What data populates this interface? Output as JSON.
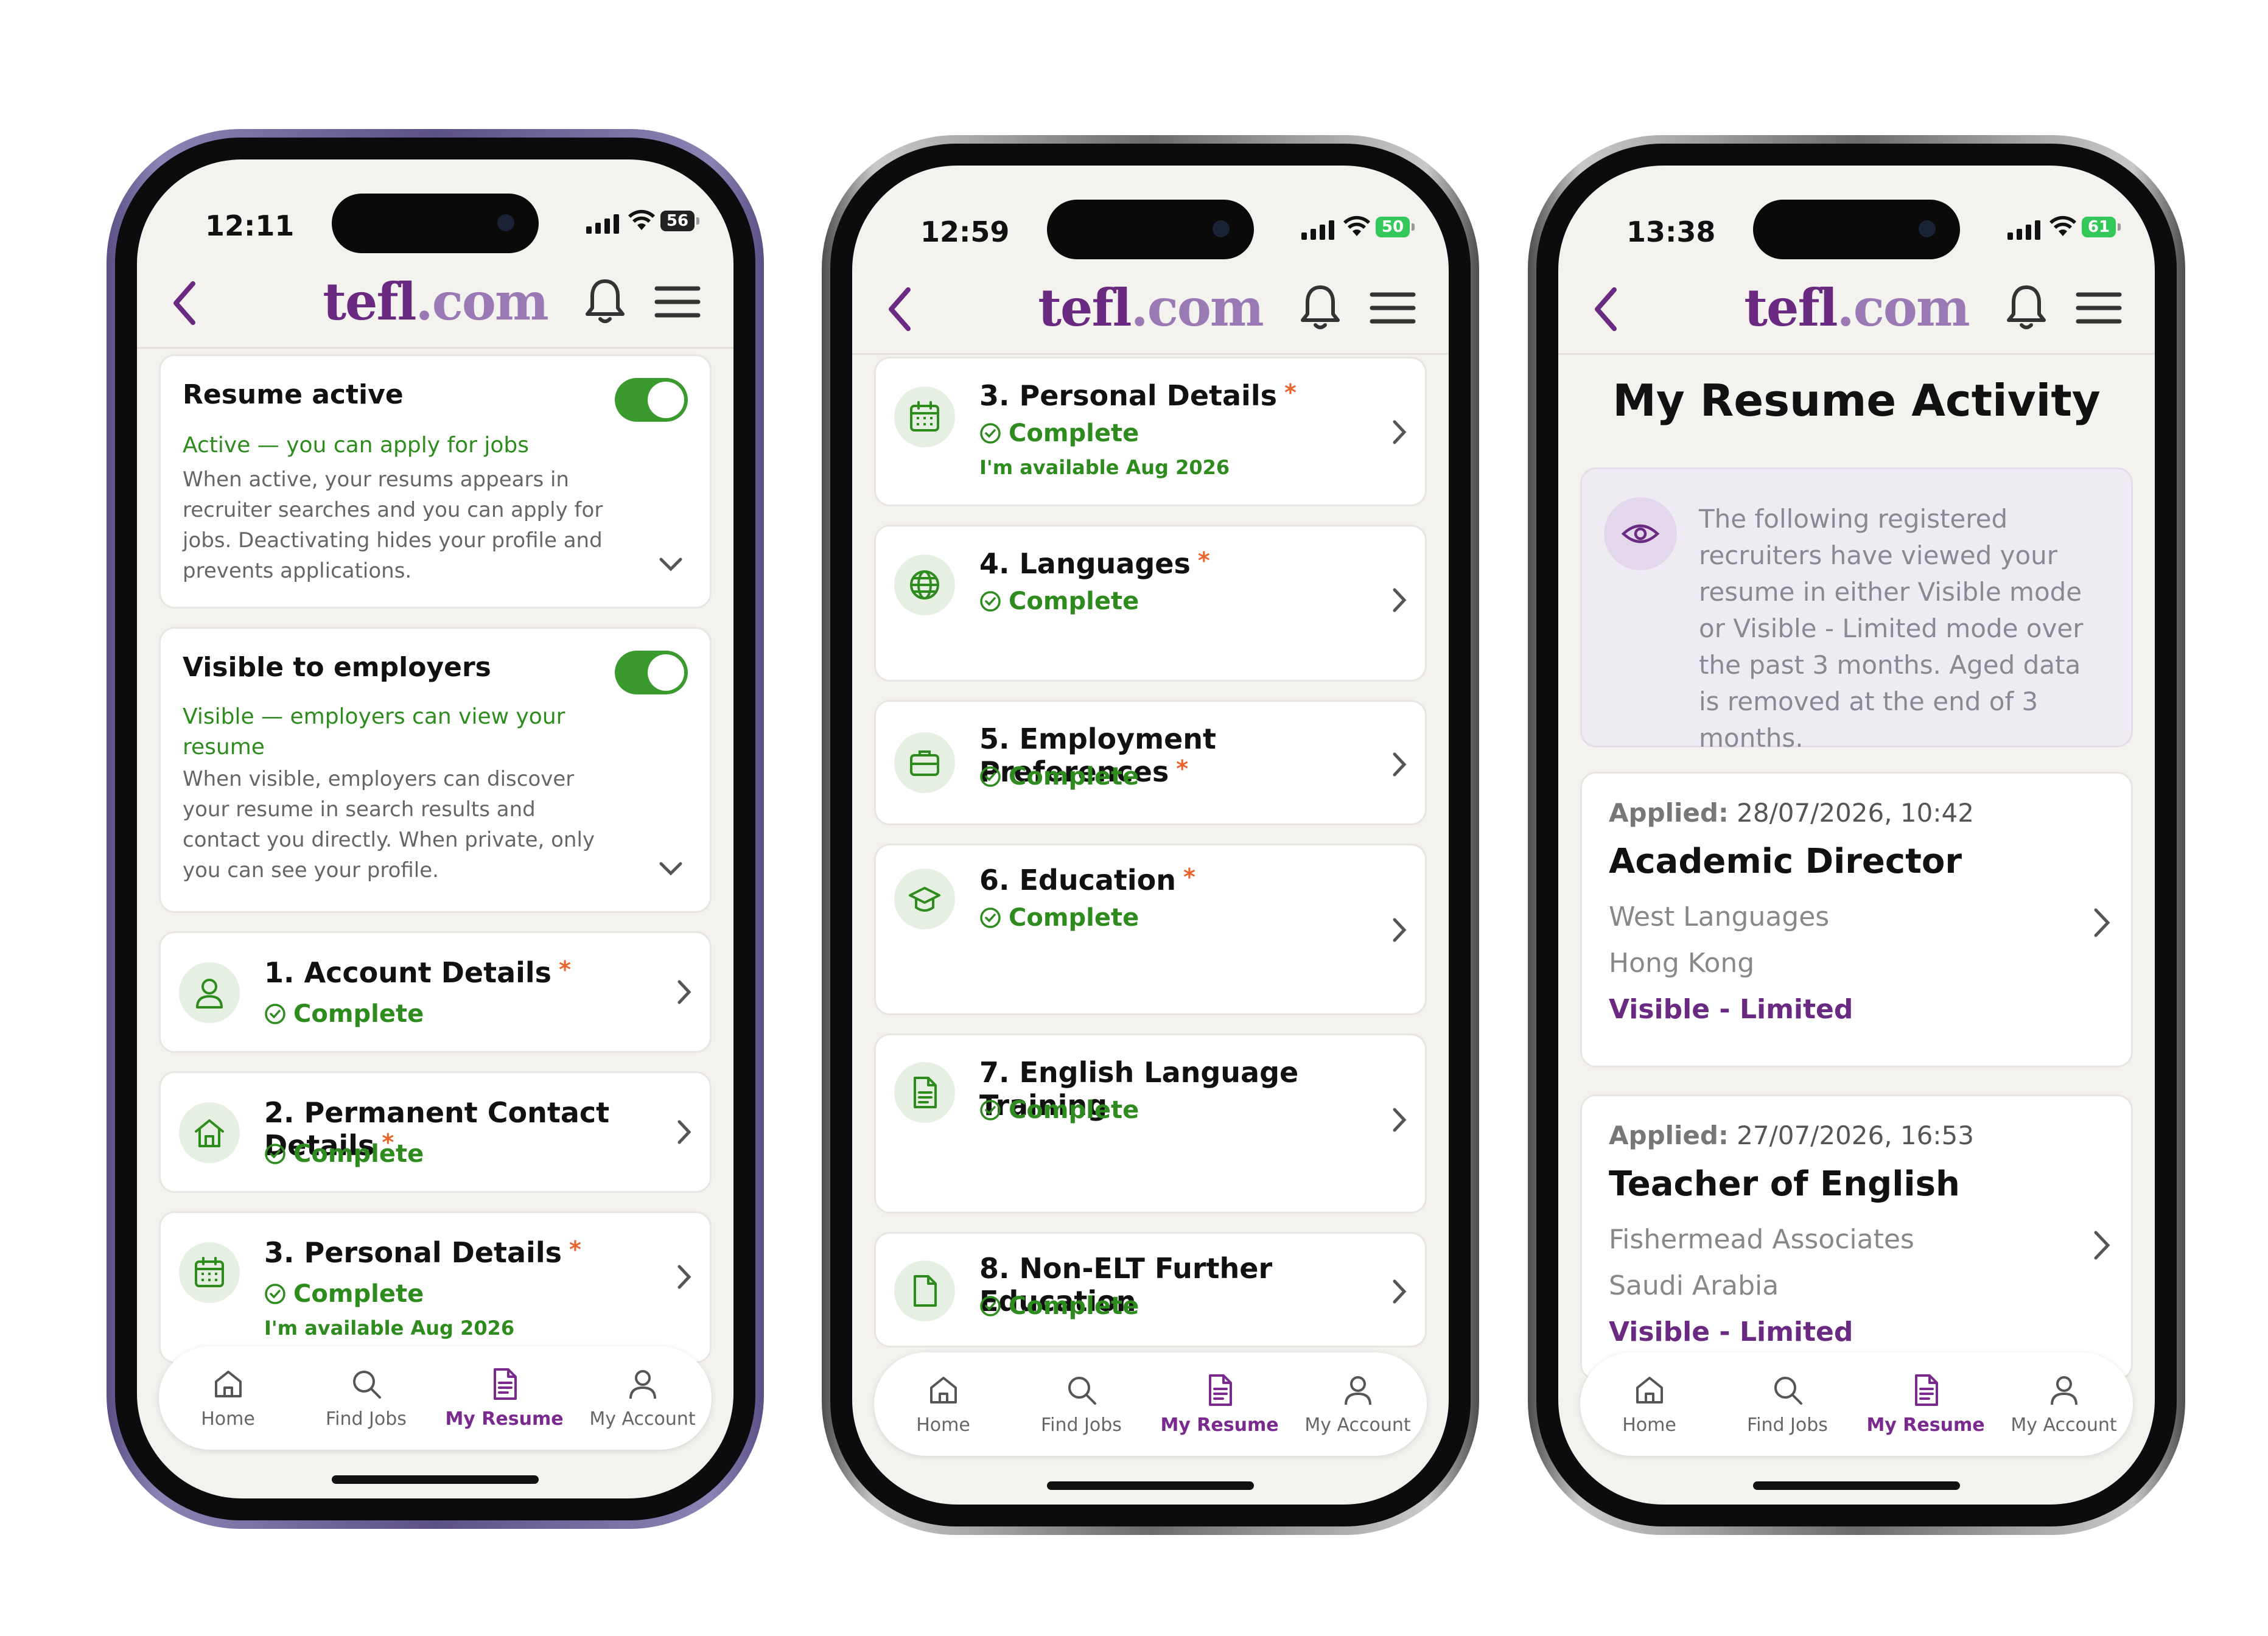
{
  "brand": {
    "logo_a": "tefl",
    "logo_b": ".com",
    "accent": "#6b2a82",
    "green": "#2e8b1e",
    "required": "#e8642c"
  },
  "nav": {
    "home": "Home",
    "find_jobs": "Find Jobs",
    "my_resume": "My Resume",
    "my_account": "My Account"
  },
  "phone1": {
    "time": "12:11",
    "battery": "56",
    "resume_active": {
      "title": "Resume active",
      "status": "Active — you can apply for jobs",
      "description": "When active, your resums appears in recruiter searches and you can apply for jobs. Deactivating hides your profile and prevents applications."
    },
    "visible": {
      "title": "Visible to employers",
      "status": "Visible — employers can view your resume",
      "description": "When visible, employers can discover your resume in search results and contact you directly. When private, only you can see your profile."
    },
    "sections": [
      {
        "title": "1. Account Details",
        "req": "*",
        "status": "Complete"
      },
      {
        "title": "2. Permanent Contact Details",
        "req": "*",
        "status": "Complete"
      },
      {
        "title": "3. Personal Details",
        "req": "*",
        "status": "Complete",
        "note": "I'm available Aug 2026"
      }
    ]
  },
  "phone2": {
    "time": "12:59",
    "battery": "50",
    "sections": [
      {
        "title": "3. Personal Details",
        "req": "*",
        "status": "Complete",
        "note": "I'm available Aug 2026"
      },
      {
        "title": "4. Languages",
        "req": "*",
        "status": "Complete"
      },
      {
        "title": "5. Employment Preferences",
        "req": "*",
        "status": "Complete"
      },
      {
        "title": "6. Education",
        "req": "*",
        "status": "Complete"
      },
      {
        "title": "7. English Language Training",
        "status": "Complete"
      },
      {
        "title": "8. Non-ELT Further Education",
        "status": "Complete"
      }
    ]
  },
  "phone3": {
    "time": "13:38",
    "battery": "61",
    "page_title": "My Resume Activity",
    "info": "The following registered recruiters have viewed your resume in either Visible mode or Visible - Limited mode over the past 3 months. Aged data is removed at the end of 3 months.",
    "applications": [
      {
        "applied_label": "Applied:",
        "applied": "28/07/2026, 10:42",
        "title": "Academic Director",
        "company": "West Languages",
        "location": "Hong Kong",
        "visibility": "Visible - Limited"
      },
      {
        "applied_label": "Applied:",
        "applied": "27/07/2026, 16:53",
        "title": "Teacher of English",
        "company": "Fishermead Associates",
        "location": "Saudi Arabia",
        "visibility": "Visible - Limited"
      }
    ]
  }
}
